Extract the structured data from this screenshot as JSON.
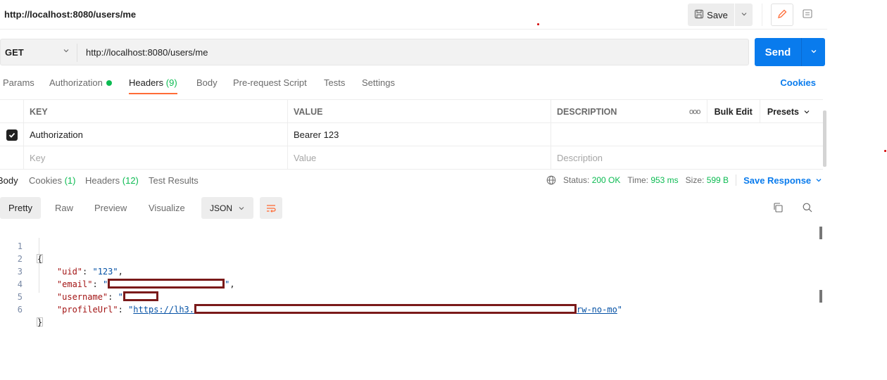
{
  "header": {
    "title": "http://localhost:8080/users/me",
    "save_label": "Save"
  },
  "request": {
    "method": "GET",
    "url": "http://localhost:8080/users/me",
    "send_label": "Send"
  },
  "request_tabs": {
    "params": "Params",
    "authorization": "Authorization",
    "headers": "Headers",
    "headers_count": "(9)",
    "body": "Body",
    "prerequest": "Pre-request Script",
    "tests": "Tests",
    "settings": "Settings",
    "cookies": "Cookies"
  },
  "headers_table": {
    "columns": {
      "key": "KEY",
      "value": "VALUE",
      "description": "DESCRIPTION"
    },
    "more_glyph": "ooo",
    "bulk_edit": "Bulk Edit",
    "presets": "Presets",
    "rows": [
      {
        "checked": true,
        "key": "Authorization",
        "value": "Bearer 123",
        "description": ""
      }
    ],
    "placeholders": {
      "key": "Key",
      "value": "Value",
      "description": "Description"
    }
  },
  "response_tabs": {
    "body": "Body",
    "cookies": "Cookies",
    "cookies_count": "(1)",
    "headers": "Headers",
    "headers_count": "(12)",
    "test_results": "Test Results"
  },
  "response_meta": {
    "status_label": "Status:",
    "status_value": "200 OK",
    "time_label": "Time:",
    "time_value": "953 ms",
    "size_label": "Size:",
    "size_value": "599 B",
    "save_response": "Save Response"
  },
  "view": {
    "pretty": "Pretty",
    "raw": "Raw",
    "preview": "Preview",
    "visualize": "Visualize",
    "format": "JSON"
  },
  "code": {
    "line_numbers": [
      "1",
      "2",
      "3",
      "4",
      "5",
      "6"
    ],
    "open_brace": "{",
    "close_brace": "}",
    "uid_key": "\"uid\"",
    "uid_value": "\"123\"",
    "email_key": "\"email\"",
    "username_key": "\"username\"",
    "profile_key": "\"profileUrl\"",
    "profile_prefix": "https://lh3.",
    "profile_suffix": "rw-no-mo"
  },
  "colors": {
    "accent": "#ff6c37",
    "primary": "#097bed",
    "success": "#0cbb52",
    "redaction": "#7a1a1a"
  }
}
